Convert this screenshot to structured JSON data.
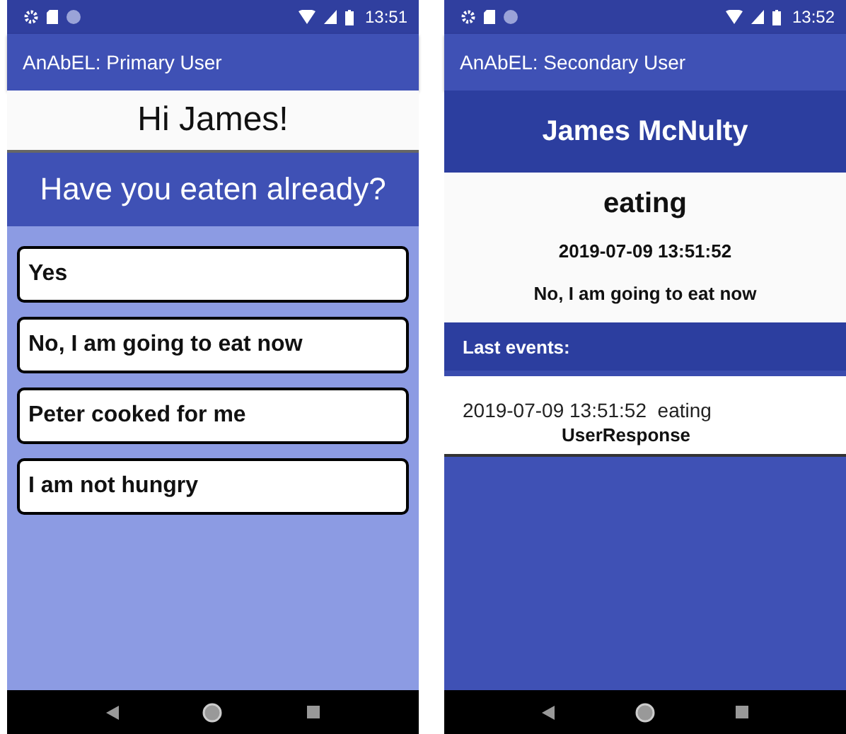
{
  "primary": {
    "status_bar": {
      "time": "13:51"
    },
    "app_bar": {
      "title": "AnAbEL: Primary User"
    },
    "greeting": "Hi James!",
    "question": "Have you eaten already?",
    "answers": [
      {
        "label": "Yes"
      },
      {
        "label": "No, I am going to eat now"
      },
      {
        "label": "Peter cooked for me"
      },
      {
        "label": "I am not hungry"
      }
    ]
  },
  "secondary": {
    "status_bar": {
      "time": "13:52"
    },
    "app_bar": {
      "title": "AnAbEL: Secondary User"
    },
    "user_name": "James McNulty",
    "status": "eating",
    "timestamp": "2019-07-09 13:51:52",
    "response": "No, I am going to eat now",
    "events_header": "Last events:",
    "events": [
      {
        "time": "2019-07-09 13:51:52",
        "status": "eating",
        "type": "UserResponse"
      }
    ]
  }
}
